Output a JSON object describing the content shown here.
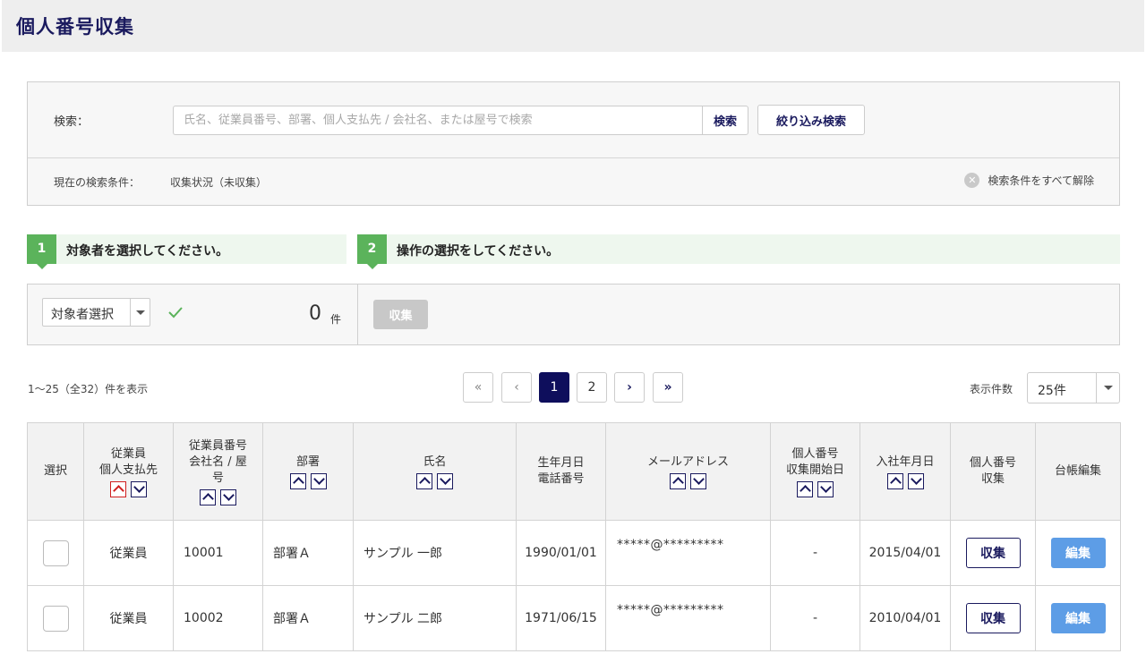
{
  "page": {
    "title": "個人番号収集"
  },
  "search": {
    "label": "検索：",
    "placeholder": "氏名、従業員番号、部署、個人支払先 / 会社名、または屋号で検索",
    "search_button": "検索",
    "filter_button": "絞り込み検索",
    "condition_label": "現在の検索条件：",
    "condition_value": "収集状況（未収集）",
    "clear_all": "検索条件をすべて解除"
  },
  "steps": [
    {
      "number": "1",
      "text": "対象者を選択してください。"
    },
    {
      "number": "2",
      "text": "操作の選択をしてください。"
    }
  ],
  "selection": {
    "dropdown_value": "対象者選択",
    "count": "0",
    "count_unit": "件",
    "collect_button": "収集"
  },
  "pagination": {
    "range_text": "1～25（全32）件を表示",
    "first": "«",
    "prev": "‹",
    "pages": [
      "1",
      "2"
    ],
    "current_page": "1",
    "next": "›",
    "last": "»",
    "per_page_label": "表示件数",
    "per_page_value": "25件"
  },
  "table": {
    "headers": {
      "select": "選択",
      "type_l1": "従業員",
      "type_l2": "個人支払先",
      "number_l1": "従業員番号",
      "number_l2": "会社名 / 屋",
      "number_l3": "号",
      "dept": "部署",
      "name": "氏名",
      "birth_l1": "生年月日",
      "birth_l2": "電話番号",
      "email": "メールアドレス",
      "start_l1": "個人番号",
      "start_l2": "収集開始日",
      "join": "入社年月日",
      "collect_l1": "個人番号",
      "collect_l2": "収集",
      "edit": "台帳編集"
    },
    "rows": [
      {
        "type": "従業員",
        "number": "10001",
        "dept": "部署Ａ",
        "name": "サンプル 一郎",
        "birth": "1990/01/01",
        "email": "*****@*********",
        "start": "-",
        "join": "2015/04/01",
        "collect": "収集",
        "edit": "編集"
      },
      {
        "type": "従業員",
        "number": "10002",
        "dept": "部署Ａ",
        "name": "サンプル 二郎",
        "birth": "1971/06/15",
        "email": "*****@*********",
        "start": "-",
        "join": "2010/04/01",
        "collect": "収集",
        "edit": "編集"
      }
    ]
  },
  "colors": {
    "accent": "#1a1a5e",
    "step_green": "#5bb35b",
    "edit_blue": "#5d9de6"
  }
}
